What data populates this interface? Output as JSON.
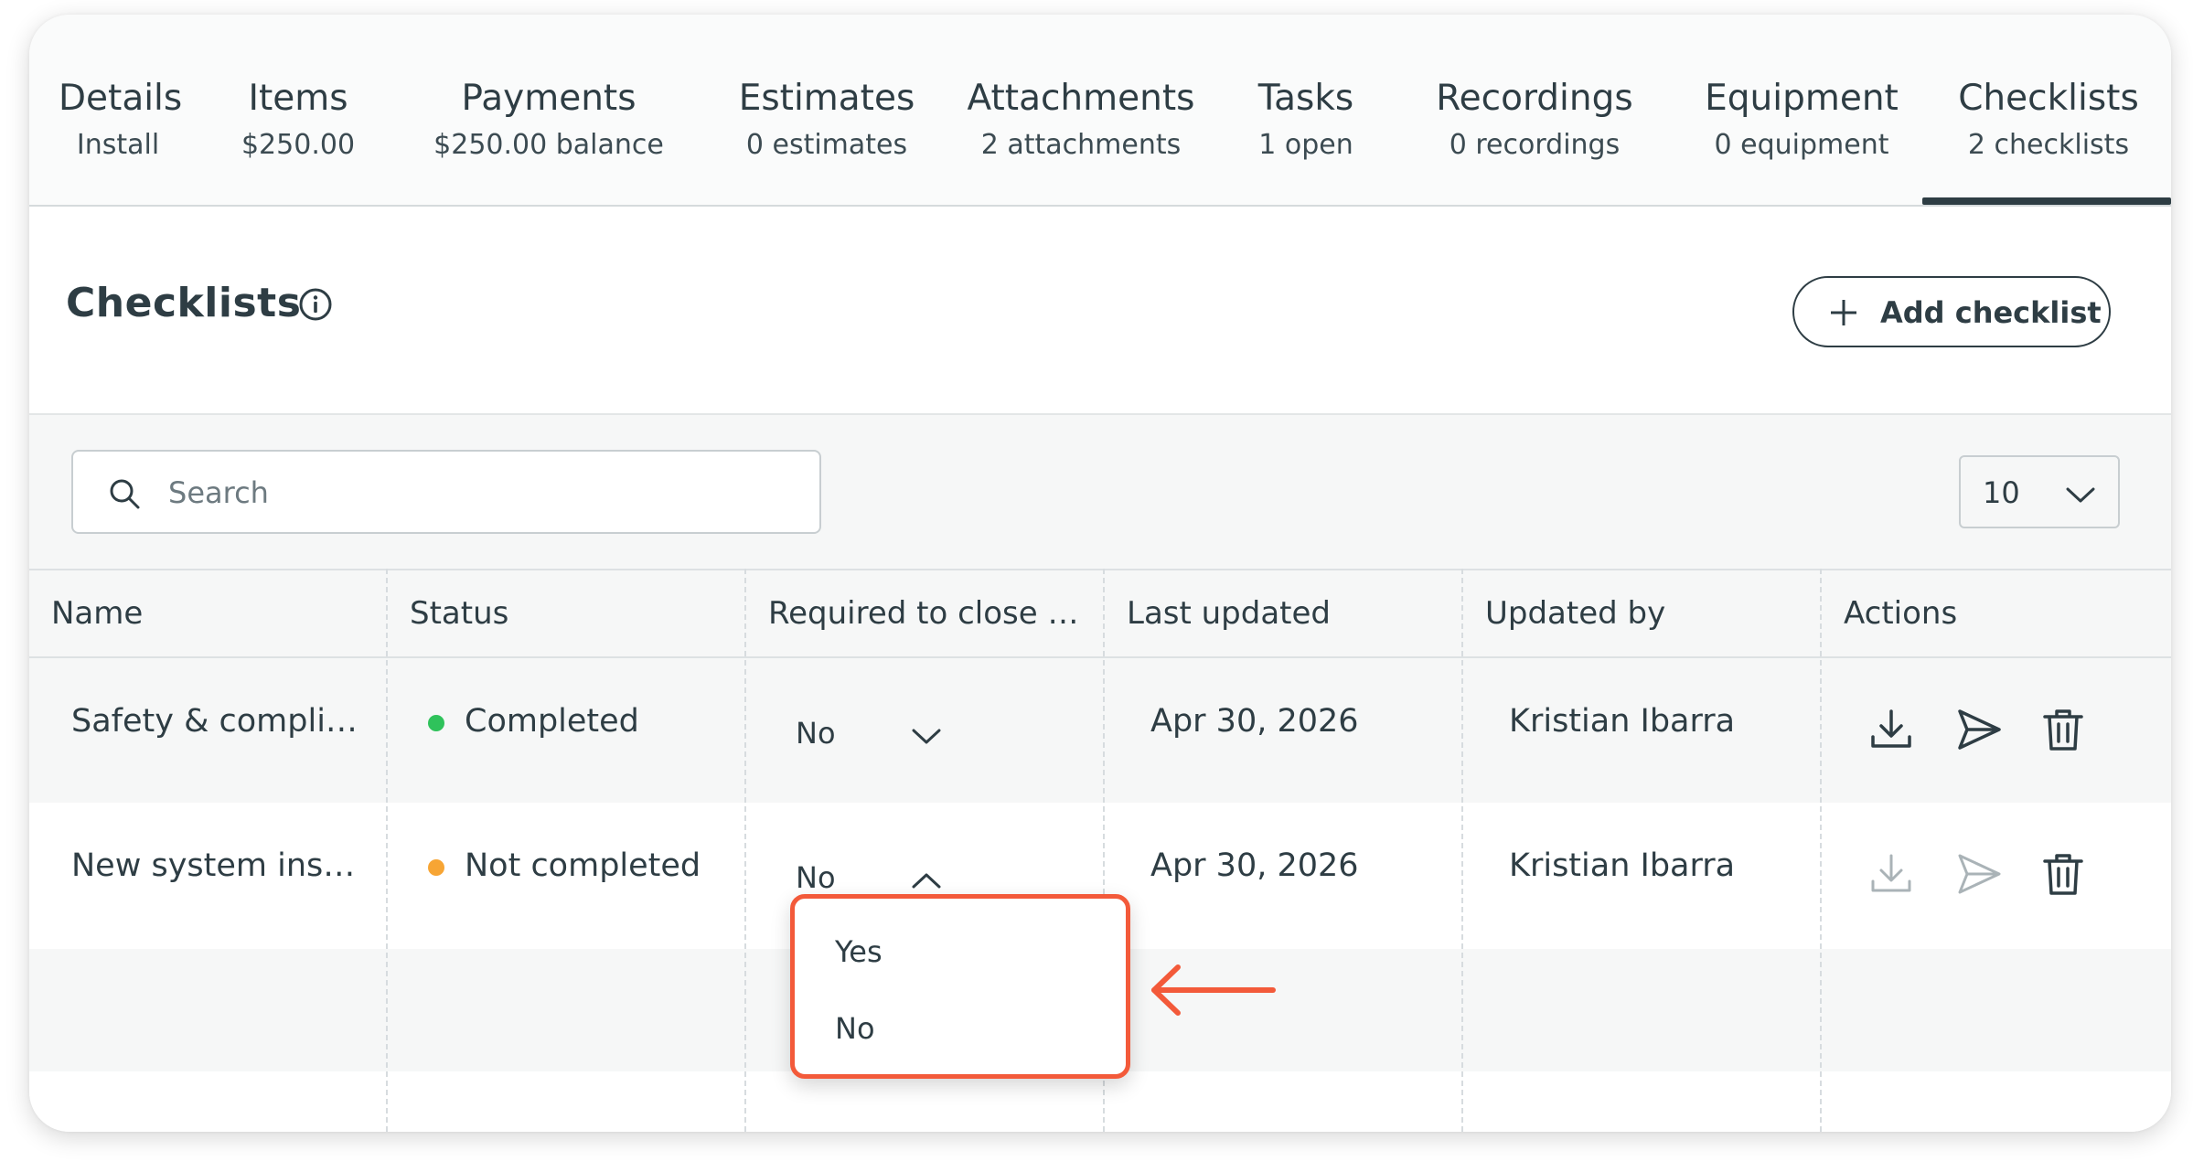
{
  "tabs": [
    {
      "label": "Details",
      "sub": "Install"
    },
    {
      "label": "Items",
      "sub": "$250.00"
    },
    {
      "label": "Payments",
      "sub": "$250.00 balance"
    },
    {
      "label": "Estimates",
      "sub": "0 estimates"
    },
    {
      "label": "Attachments",
      "sub": "2 attachments"
    },
    {
      "label": "Tasks",
      "sub": "1 open"
    },
    {
      "label": "Recordings",
      "sub": "0 recordings"
    },
    {
      "label": "Equipment",
      "sub": "0 equipment"
    },
    {
      "label": "Checklists",
      "sub": "2 checklists"
    }
  ],
  "active_tab": "Checklists",
  "header": {
    "title": "Checklists",
    "add_label": "Add checklist"
  },
  "toolbar": {
    "search_placeholder": "Search",
    "page_size": "10"
  },
  "table": {
    "columns": [
      "Name",
      "Status",
      "Required to close …",
      "Last updated",
      "Updated by",
      "Actions"
    ],
    "rows": [
      {
        "name": "Safety & compli…",
        "status": "Completed",
        "status_color": "#2fc25b",
        "required": "No",
        "last_updated": "Apr 30, 2026",
        "updated_by": "Kristian Ibarra",
        "actions_enabled": true
      },
      {
        "name": "New system ins…",
        "status": "Not completed",
        "status_color": "#f7a534",
        "required": "No",
        "last_updated": "Apr 30, 2026",
        "updated_by": "Kristian Ibarra",
        "actions_enabled": false
      }
    ]
  },
  "dropdown": {
    "options": [
      "Yes",
      "No"
    ]
  },
  "colors": {
    "text": "#2e3d44",
    "highlight": "#f35a3a",
    "active_underline": "#2e3d44"
  },
  "icons": [
    "info-icon",
    "plus-icon",
    "search-icon",
    "chevron-down-icon",
    "chevron-up-icon",
    "download-icon",
    "send-icon",
    "trash-icon",
    "arrow-left-icon"
  ]
}
